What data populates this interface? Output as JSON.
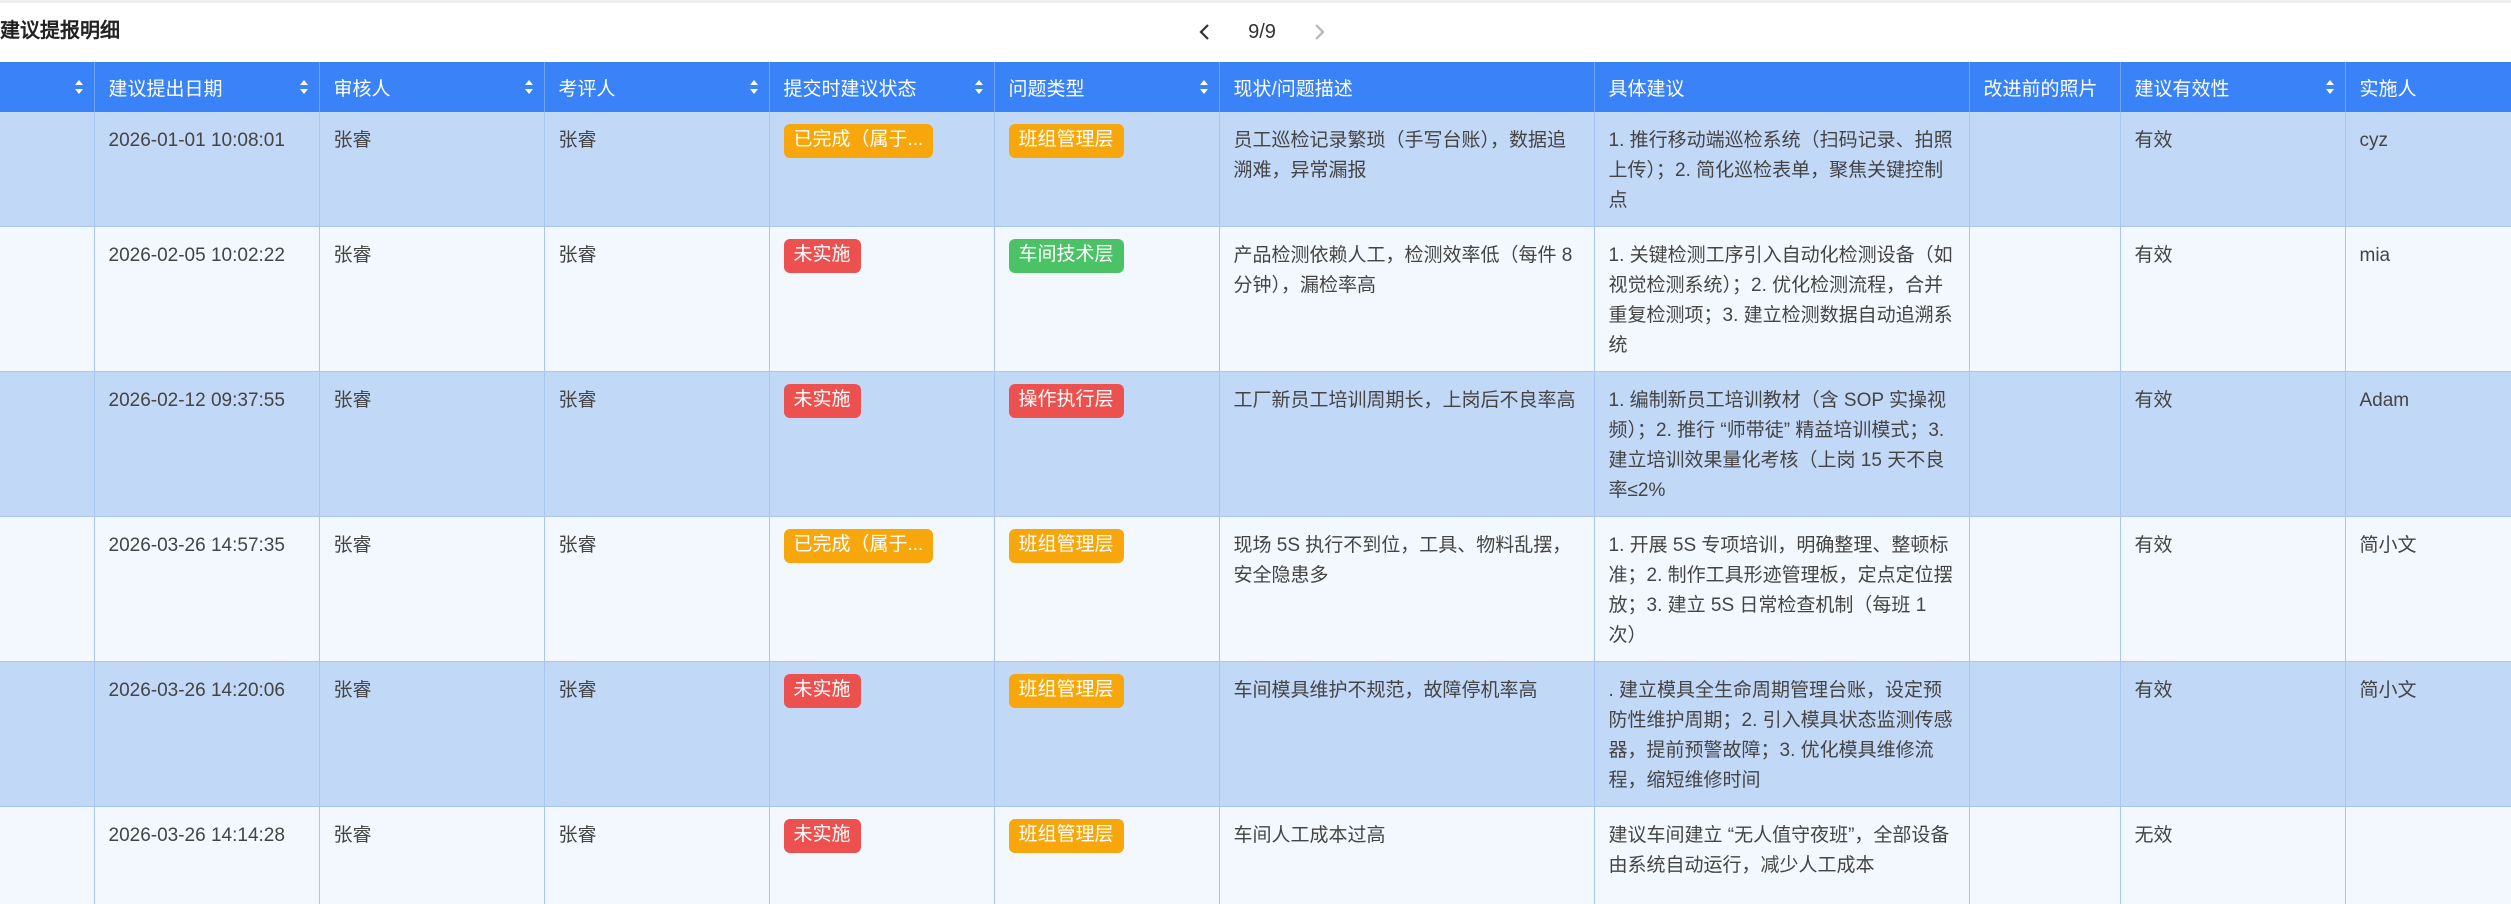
{
  "title": "建议提报明细",
  "pager": {
    "page_text": "9/9",
    "prev_icon": "chevron-left-icon",
    "next_icon": "chevron-right-icon"
  },
  "columns": [
    "",
    "建议提出日期",
    "审核人",
    "考评人",
    "提交时建议状态",
    "问题类型",
    "现状/问题描述",
    "具体建议",
    "改进前的照片",
    "建议有效性",
    "实施人"
  ],
  "colors": {
    "header_bg": "#3a82f7",
    "row_odd": "#c1d8f7",
    "row_even": "#f3f8fe",
    "tag_orange": "#f7a70b",
    "tag_red": "#ec5150",
    "tag_green": "#4cc267"
  },
  "rows": [
    {
      "date": "2026-01-01 10:08:01",
      "reviewer": "张睿",
      "evaluator": "张睿",
      "status": "已完成（属于...",
      "status_color": "orange",
      "type": "班组管理层",
      "type_color": "orange",
      "desc": "员工巡检记录繁琐（手写台账），数据追溯难，异常漏报",
      "suggestion": "1. 推行移动端巡检系统（扫码记录、拍照上传）；2. 简化巡检表单，聚焦关键控制点",
      "photo": "",
      "validity": "有效",
      "implementer": "cyz"
    },
    {
      "date": "2026-02-05 10:02:22",
      "reviewer": "张睿",
      "evaluator": "张睿",
      "status": "未实施",
      "status_color": "red",
      "type": "车间技术层",
      "type_color": "green",
      "desc": "产品检测依赖人工，检测效率低（每件 8 分钟），漏检率高",
      "suggestion": "1. 关键检测工序引入自动化检测设备（如视觉检测系统）；2. 优化检测流程，合并重复检测项；3. 建立检测数据自动追溯系统",
      "photo": "",
      "validity": "有效",
      "implementer": "mia"
    },
    {
      "date": "2026-02-12 09:37:55",
      "reviewer": "张睿",
      "evaluator": "张睿",
      "status": "未实施",
      "status_color": "red",
      "type": "操作执行层",
      "type_color": "red",
      "desc": "工厂新员工培训周期长，上岗后不良率高",
      "suggestion": "1. 编制新员工培训教材（含 SOP 实操视频）；2. 推行 “师带徒” 精益培训模式；3. 建立培训效果量化考核（上岗 15 天不良率≤2%",
      "photo": "",
      "validity": "有效",
      "implementer": "Adam"
    },
    {
      "date": "2026-03-26 14:57:35",
      "reviewer": "张睿",
      "evaluator": "张睿",
      "status": "已完成（属于...",
      "status_color": "orange",
      "type": "班组管理层",
      "type_color": "orange",
      "desc": "现场 5S 执行不到位，工具、物料乱摆，安全隐患多",
      "suggestion": "1. 开展 5S 专项培训，明确整理、整顿标准；2. 制作工具形迹管理板，定点定位摆放；3. 建立 5S 日常检查机制（每班 1 次）",
      "photo": "",
      "validity": "有效",
      "implementer": "简小文"
    },
    {
      "date": "2026-03-26 14:20:06",
      "reviewer": "张睿",
      "evaluator": "张睿",
      "status": "未实施",
      "status_color": "red",
      "type": "班组管理层",
      "type_color": "orange",
      "desc": "车间模具维护不规范，故障停机率高",
      "suggestion": ". 建立模具全生命周期管理台账，设定预防性维护周期；2. 引入模具状态监测传感器，提前预警故障；3. 优化模具维修流程，缩短维修时间",
      "photo": "",
      "validity": "有效",
      "implementer": "简小文"
    },
    {
      "date": "2026-03-26 14:14:28",
      "reviewer": "张睿",
      "evaluator": "张睿",
      "status": "未实施",
      "status_color": "red",
      "type": "班组管理层",
      "type_color": "orange",
      "desc": "车间人工成本过高",
      "suggestion": "建议车间建立 “无人值守夜班”，全部设备由系统自动运行，减少人工成本",
      "photo": "",
      "validity": "无效",
      "implementer": ""
    }
  ]
}
